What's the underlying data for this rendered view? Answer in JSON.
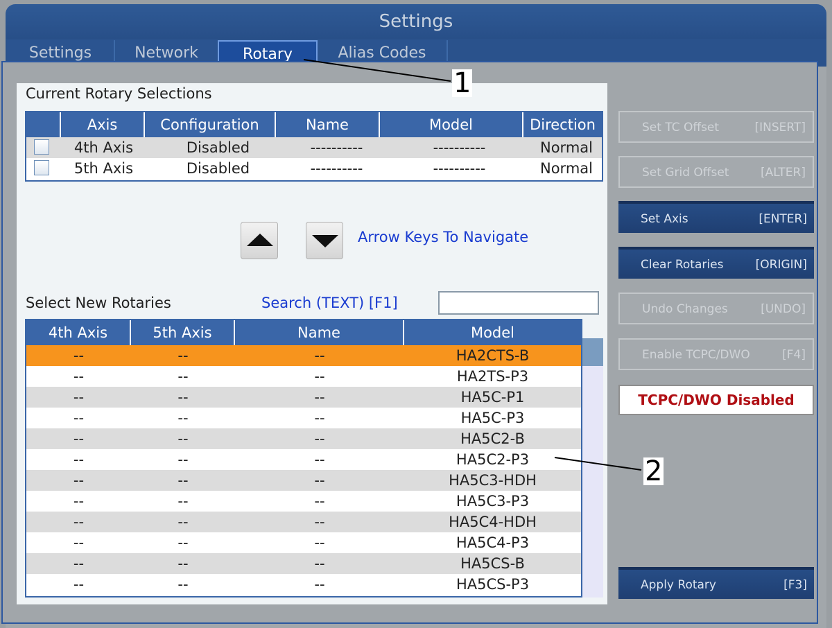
{
  "window": {
    "title": "Settings"
  },
  "tabs": [
    {
      "label": "Settings"
    },
    {
      "label": "Network"
    },
    {
      "label": "Rotary"
    },
    {
      "label": "Alias Codes"
    }
  ],
  "current": {
    "title": "Current Rotary Selections",
    "headers": [
      "Axis",
      "Configuration",
      "Name",
      "Model",
      "Direction"
    ],
    "rows": [
      {
        "axis": "4th Axis",
        "config": "Disabled",
        "name": "----------",
        "model": "----------",
        "direction": "Normal"
      },
      {
        "axis": "5th Axis",
        "config": "Disabled",
        "name": "----------",
        "model": "----------",
        "direction": "Normal"
      }
    ]
  },
  "nav": {
    "hint": "Arrow Keys To Navigate"
  },
  "select_new": {
    "title": "Select New Rotaries",
    "search_label": "Search (TEXT) [F1]",
    "search_value": "",
    "headers": [
      "4th Axis",
      "5th Axis",
      "Name",
      "Model"
    ],
    "rows": [
      {
        "a4": "--",
        "a5": "--",
        "name": "--",
        "model": "HA2CTS-B"
      },
      {
        "a4": "--",
        "a5": "--",
        "name": "--",
        "model": "HA2TS-P3"
      },
      {
        "a4": "--",
        "a5": "--",
        "name": "--",
        "model": "HA5C-P1"
      },
      {
        "a4": "--",
        "a5": "--",
        "name": "--",
        "model": "HA5C-P3"
      },
      {
        "a4": "--",
        "a5": "--",
        "name": "--",
        "model": "HA5C2-B"
      },
      {
        "a4": "--",
        "a5": "--",
        "name": "--",
        "model": "HA5C2-P3"
      },
      {
        "a4": "--",
        "a5": "--",
        "name": "--",
        "model": "HA5C3-HDH"
      },
      {
        "a4": "--",
        "a5": "--",
        "name": "--",
        "model": "HA5C3-P3"
      },
      {
        "a4": "--",
        "a5": "--",
        "name": "--",
        "model": "HA5C4-HDH"
      },
      {
        "a4": "--",
        "a5": "--",
        "name": "--",
        "model": "HA5C4-P3"
      },
      {
        "a4": "--",
        "a5": "--",
        "name": "--",
        "model": "HA5CS-B"
      },
      {
        "a4": "--",
        "a5": "--",
        "name": "--",
        "model": "HA5CS-P3"
      }
    ]
  },
  "side": {
    "tc_offset": {
      "label": "Set TC Offset",
      "key": "[INSERT]"
    },
    "grid_offset": {
      "label": "Set Grid Offset",
      "key": "[ALTER]"
    },
    "set_axis": {
      "label": "Set Axis",
      "key": "[ENTER]"
    },
    "clear_rotaries": {
      "label": "Clear Rotaries",
      "key": "[ORIGIN]"
    },
    "undo": {
      "label": "Undo Changes",
      "key": "[UNDO]"
    },
    "enable_tcpc": {
      "label": "Enable TCPC/DWO",
      "key": "[F4]"
    },
    "status": "TCPC/DWO Disabled",
    "apply": {
      "label": "Apply Rotary",
      "key": "[F3]"
    }
  },
  "callouts": {
    "one": "1",
    "two": "2"
  },
  "colors": {
    "selected_row": "#f7941d",
    "header_blue": "#3a66a8",
    "alt_row": "#dcdcdc",
    "status_red": "#b00f14"
  }
}
